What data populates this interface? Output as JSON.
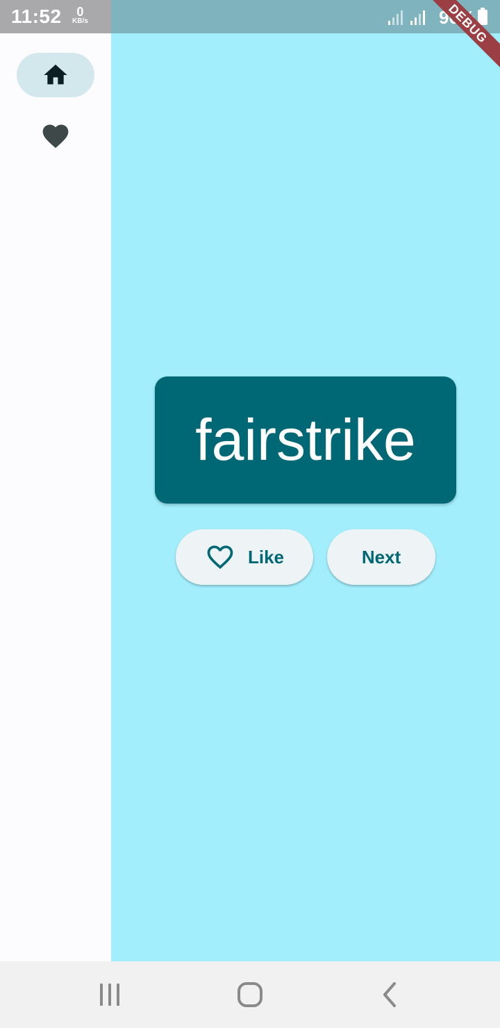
{
  "status_bar": {
    "time": "11:52",
    "net_speed": "0",
    "net_unit": "KB/s",
    "battery": "90%",
    "debug_banner": "DEBUG"
  },
  "nav_rail": {
    "items": [
      {
        "name": "home",
        "icon": "home-icon",
        "selected": true
      },
      {
        "name": "favorites",
        "icon": "heart-icon",
        "selected": false
      }
    ]
  },
  "main": {
    "word": "fairstrike",
    "like_label": "Like",
    "next_label": "Next"
  },
  "colors": {
    "primary": "#006874",
    "background": "#a2eefd",
    "rail_background": "#fcfcfe",
    "rail_selected": "#d2e8ed"
  },
  "system_nav": {
    "buttons": [
      "recents-icon",
      "home-circle-icon",
      "back-icon"
    ]
  }
}
